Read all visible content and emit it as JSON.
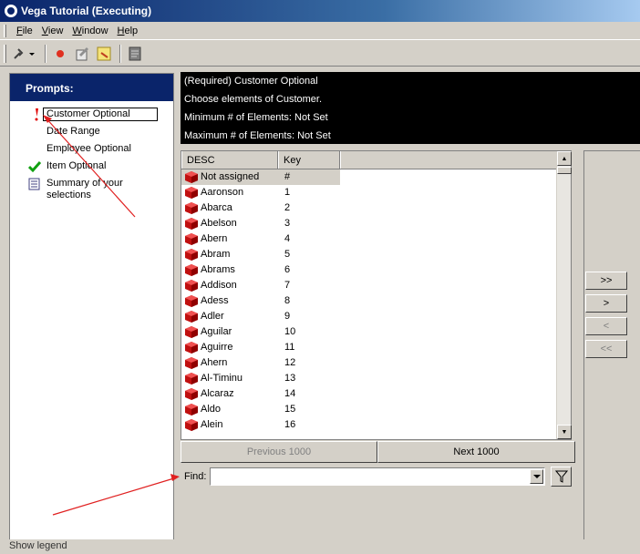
{
  "window": {
    "title": "Vega Tutorial (Executing)"
  },
  "menu": [
    "File",
    "View",
    "Window",
    "Help"
  ],
  "toolbar": {
    "icons": [
      "tools-icon",
      "record-icon",
      "edit-icon",
      "note-icon",
      "document-icon"
    ]
  },
  "prompts": {
    "header": "Prompts:",
    "items": [
      {
        "label": "Customer Optional",
        "status": "required-icon"
      },
      {
        "label": "Date Range",
        "status": ""
      },
      {
        "label": "Employee Optional",
        "status": ""
      },
      {
        "label": "Item Optional",
        "status": "checkmark-icon"
      },
      {
        "label": "Summary of your selections",
        "status": "summary-icon"
      }
    ]
  },
  "info": {
    "line1": "(Required) Customer Optional",
    "line2": "Choose elements of Customer.",
    "line3": "Minimum # of Elements: Not Set",
    "line4": "Maximum # of Elements: Not Set"
  },
  "grid": {
    "columns": [
      "DESC",
      "Key"
    ],
    "first_row": {
      "desc": "Not assigned",
      "key": "#"
    },
    "rows": [
      [
        "Aaronson",
        "1"
      ],
      [
        "Abarca",
        "2"
      ],
      [
        "Abelson",
        "3"
      ],
      [
        "Abern",
        "4"
      ],
      [
        "Abram",
        "5"
      ],
      [
        "Abrams",
        "6"
      ],
      [
        "Addison",
        "7"
      ],
      [
        "Adess",
        "8"
      ],
      [
        "Adler",
        "9"
      ],
      [
        "Aguilar",
        "10"
      ],
      [
        "Aguirre",
        "11"
      ],
      [
        "Ahern",
        "12"
      ],
      [
        "Al-Timinu",
        "13"
      ],
      [
        "Alcaraz",
        "14"
      ],
      [
        "Aldo",
        "15"
      ],
      [
        "Alein",
        "16"
      ]
    ]
  },
  "paging": {
    "previous": "Previous 1000",
    "next": "Next 1000"
  },
  "find": {
    "label": "Find:",
    "value": ""
  },
  "move_buttons": [
    ">>",
    ">",
    "<",
    "<<"
  ],
  "status_bar": "Show legend",
  "colors": {
    "accent": "#0a246a",
    "info_bg": "#000000",
    "required": "#ff0000",
    "annotation_arrow": "#e02020"
  }
}
